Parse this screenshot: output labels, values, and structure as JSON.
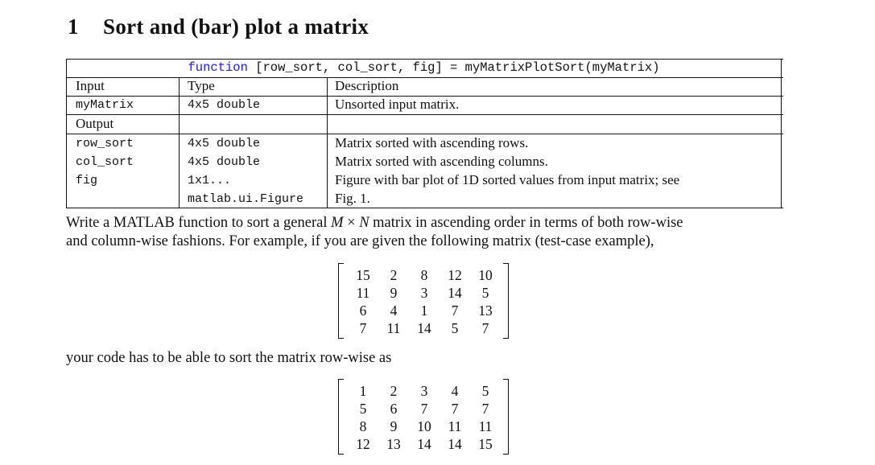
{
  "section": {
    "number": "1",
    "title": "Sort and (bar) plot a matrix"
  },
  "spec_table": {
    "signature": {
      "keyword": "function",
      "rest": " [row_sort, col_sort, fig] = myMatrixPlotSort(myMatrix)"
    },
    "input_header": {
      "label": "Input",
      "type": "Type",
      "description": "Description"
    },
    "inputs": [
      {
        "name": "myMatrix",
        "type": "4x5 double",
        "description": "Unsorted input matrix."
      }
    ],
    "output_header": {
      "label": "Output"
    },
    "outputs": [
      {
        "name": "row_sort",
        "type": "4x5 double",
        "description": "Matrix sorted with ascending rows."
      },
      {
        "name": "col_sort",
        "type": "4x5 double",
        "description": "Matrix sorted with ascending columns."
      },
      {
        "name": "fig",
        "type": "1x1...",
        "type_line2": "matlab.ui.Figure",
        "description": "Figure with bar plot of 1D sorted values from input matrix; see",
        "description_line2": "Fig. 1."
      }
    ]
  },
  "paragraph1": {
    "line1_a": "Write a MATLAB function to sort a general ",
    "M": "M",
    "times": " × ",
    "N": "N",
    "line1_b": " matrix in ascending order in terms of both row-wise",
    "line2": "and column-wise fashions. For example, if you are given the following matrix (test-case example),"
  },
  "matrix_input": [
    [
      "15",
      "2",
      "8",
      "12",
      "10"
    ],
    [
      "11",
      "9",
      "3",
      "14",
      "5"
    ],
    [
      "6",
      "4",
      "1",
      "7",
      "13"
    ],
    [
      "7",
      "11",
      "14",
      "5",
      "7"
    ]
  ],
  "paragraph2": "your code has to be able to sort the matrix row-wise as",
  "matrix_row_sorted": [
    [
      "1",
      "2",
      "3",
      "4",
      "5"
    ],
    [
      "5",
      "6",
      "7",
      "7",
      "7"
    ],
    [
      "8",
      "9",
      "10",
      "11",
      "11"
    ],
    [
      "12",
      "13",
      "14",
      "14",
      "15"
    ]
  ]
}
